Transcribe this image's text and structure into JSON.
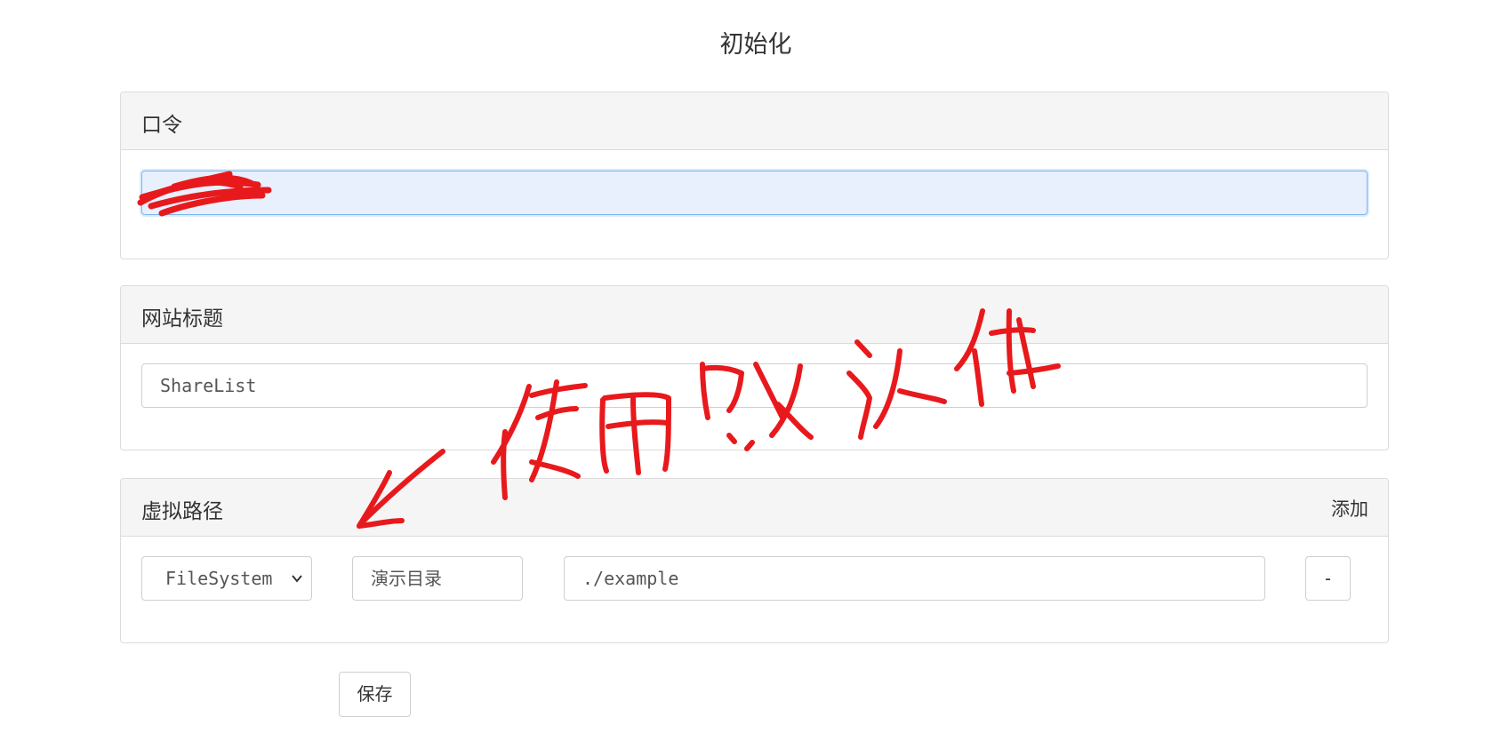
{
  "page": {
    "title": "初始化"
  },
  "password_panel": {
    "header": "口令",
    "value": ""
  },
  "site_title_panel": {
    "header": "网站标题",
    "value": "ShareList"
  },
  "virtual_path_panel": {
    "header": "虚拟路径",
    "add_label": "添加",
    "row": {
      "type_selected": "FileSystem",
      "name_value": "演示目录",
      "path_value": "./example",
      "remove_label": "-"
    }
  },
  "save_button": {
    "label": "保存"
  },
  "annotation": {
    "handwritten_text": "使用默认值",
    "color": "#e8191c"
  },
  "colors": {
    "focus_fill": "#e8f0fe",
    "focus_border": "#7fb5ec",
    "panel_header_bg": "#f5f5f5",
    "border": "#dcdcdc"
  }
}
